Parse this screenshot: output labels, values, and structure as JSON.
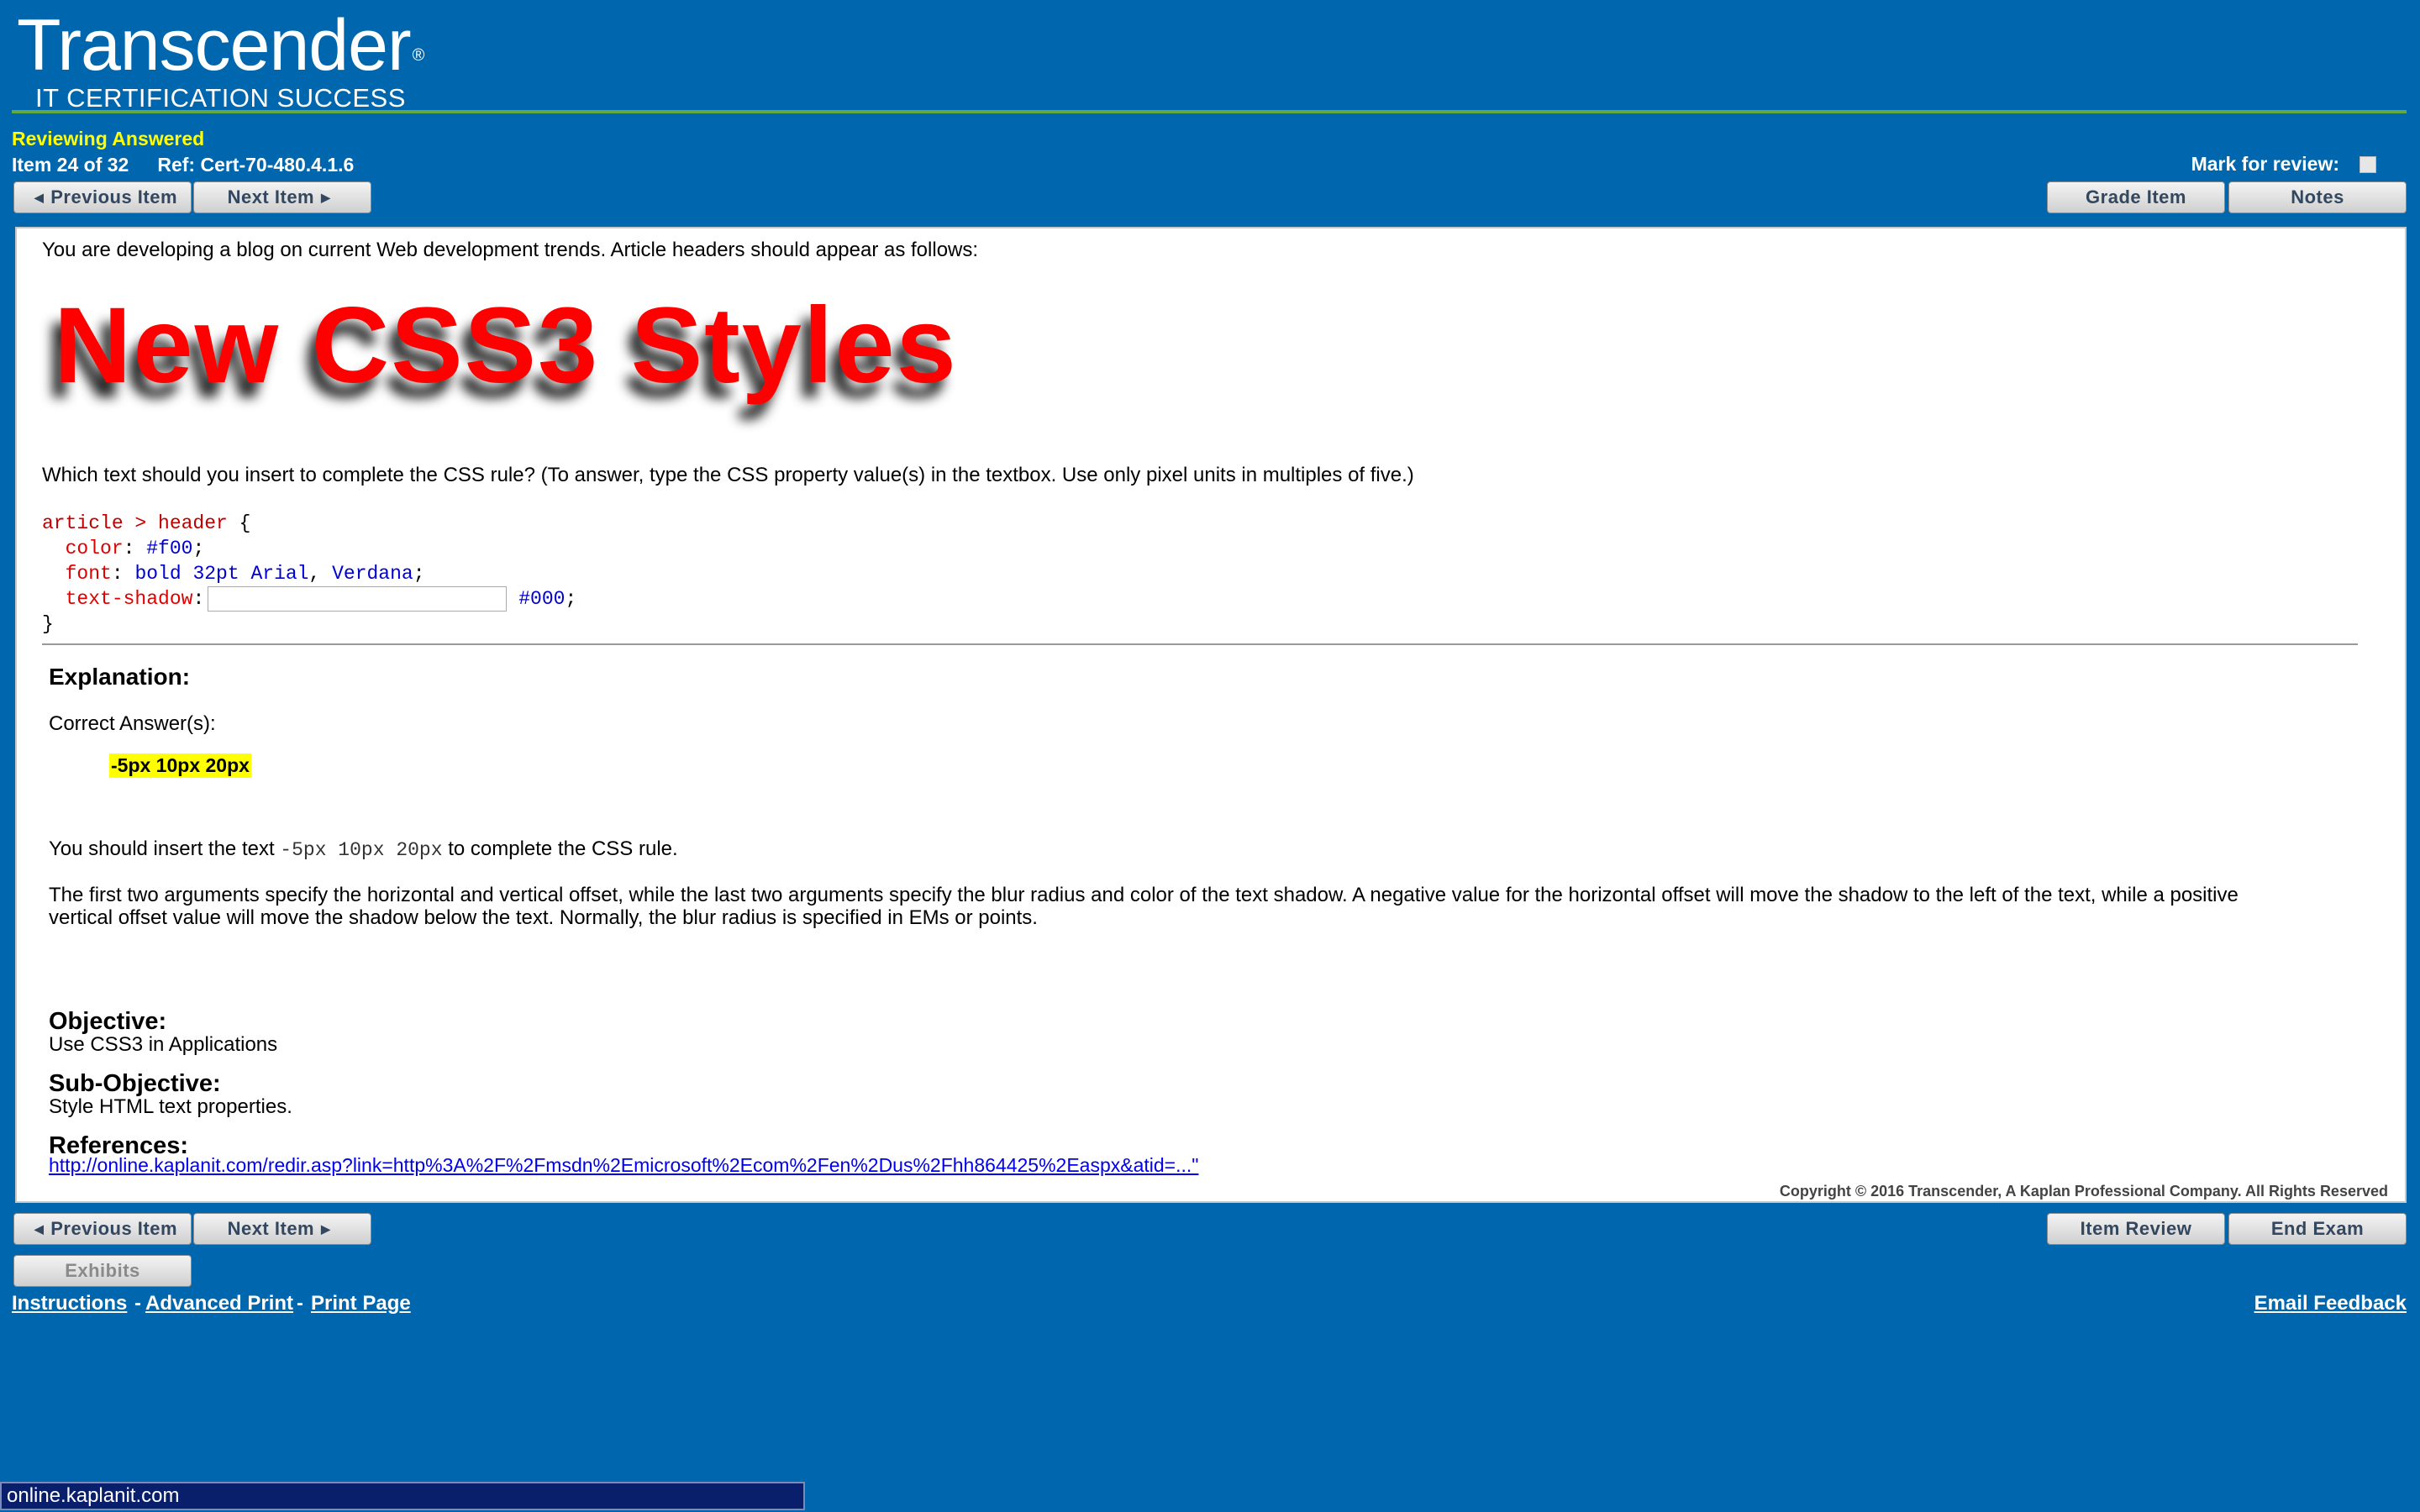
{
  "header": {
    "logo_main": "Transcender",
    "logo_reg": "®",
    "logo_sub": "IT CERTIFICATION SUCCESS"
  },
  "status": {
    "mode": "Reviewing Answered",
    "item": "Item 24 of 32",
    "ref": "Ref: Cert-70-480.4.1.6",
    "mark_label": "Mark for review:"
  },
  "nav_top": {
    "prev": "Previous Item",
    "next": "Next Item",
    "grade": "Grade Item",
    "notes": "Notes"
  },
  "question": {
    "intro": "You are developing a blog on current Web development trends. Article headers should appear as follows:",
    "sample_heading": "New CSS3 Styles",
    "prompt": "Which text should you insert to complete the CSS rule? (To answer, type the CSS property value(s) in the textbox. Use only pixel units in multiples of five.)",
    "code": {
      "selector": "article > header",
      "open": " {",
      "color_prop": "color",
      "color_val": "#f00",
      "font_prop": "font",
      "font_val1": "bold 32pt Arial",
      "font_val2": "Verdana",
      "shadow_prop": "text-shadow",
      "shadow_input_value": "",
      "shadow_color": "#000",
      "close": "}"
    }
  },
  "explanation": {
    "heading": "Explanation:",
    "correct_label": "Correct Answer(s):",
    "answer": "-5px 10px 20px",
    "para1_a": "You should insert the text ",
    "para1_code": "-5px 10px 20px",
    "para1_b": " to complete the CSS rule.",
    "para2": "The first two arguments specify the horizontal and vertical offset, while the last two arguments specify the blur radius and color of the text shadow. A negative value for the horizontal offset will move the shadow to the left of the text, while a positive vertical offset value will move the shadow below the text. Normally, the blur radius is specified in EMs or points.",
    "objective_h": "Objective:",
    "objective": "Use CSS3 in Applications",
    "subobjective_h": "Sub-Objective:",
    "subobjective": "Style HTML text properties.",
    "references_h": "References:",
    "reference_link": "http://online.kaplanit.com/redir.asp?link=http%3A%2F%2Fmsdn%2Emicrosoft%2Ecom%2Fen%2Dus%2Fhh864425%2Easpx&atid=...\"",
    "copyright": "Copyright © 2016 Transcender, A Kaplan Professional Company. All Rights Reserved"
  },
  "nav_bottom": {
    "prev": "Previous Item",
    "next": "Next Item",
    "item_review": "Item Review",
    "end_exam": "End Exam",
    "exhibits": "Exhibits"
  },
  "footer_links": {
    "instructions": "Instructions",
    "sep1": "-",
    "advanced_print": "Advanced Print",
    "sep2": "-",
    "print_page": "Print Page",
    "email_feedback": "Email Feedback"
  },
  "browser_status": "online.kaplanit.com"
}
